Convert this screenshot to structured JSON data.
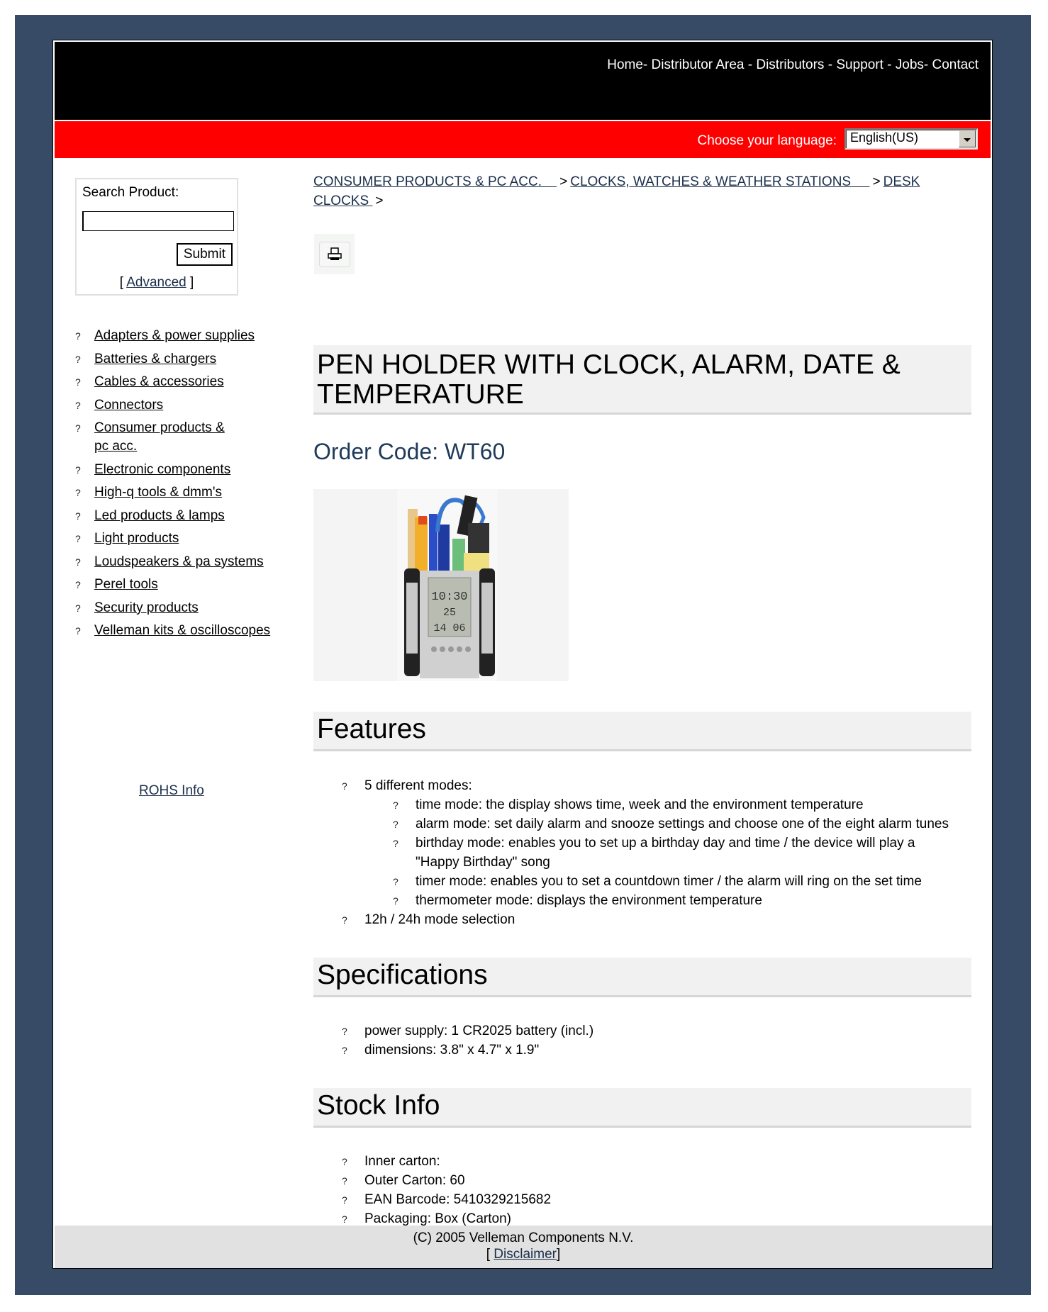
{
  "header": {
    "nav": [
      {
        "label": "Home"
      },
      {
        "label": "Distributor Area"
      },
      {
        "label": "Distributors"
      },
      {
        "label": "Support"
      },
      {
        "label": "Jobs"
      },
      {
        "label": "Contact"
      }
    ],
    "nav_separator": "-"
  },
  "language": {
    "label": "Choose your language:",
    "selected": "English(US)"
  },
  "search": {
    "label": "Search Product:",
    "value": "",
    "submit_label": "Submit",
    "advanced_prefix": "[",
    "advanced_label": "Advanced",
    "advanced_suffix": "]"
  },
  "categories": [
    {
      "label": "Adapters & power supplies"
    },
    {
      "label": "Batteries & chargers"
    },
    {
      "label": "Cables & accessories"
    },
    {
      "label": "Connectors"
    },
    {
      "label": "Consumer products & pc acc."
    },
    {
      "label": "Electronic components"
    },
    {
      "label": "High-q tools & dmm's"
    },
    {
      "label": "Led products & lamps"
    },
    {
      "label": "Light products"
    },
    {
      "label": "Loudspeakers & pa systems"
    },
    {
      "label": "Perel tools"
    },
    {
      "label": "Security products"
    },
    {
      "label": "Velleman kits & oscilloscopes"
    }
  ],
  "bullet_glyph": "?",
  "rohs_label": "ROHS Info",
  "breadcrumb": {
    "items": [
      {
        "label": "CONSUMER PRODUCTS & PC ACC."
      },
      {
        "label": "CLOCKS, WATCHES & WEATHER STATIONS"
      },
      {
        "label": "DESK CLOCKS"
      }
    ],
    "separator": ">"
  },
  "product": {
    "title": "PEN HOLDER WITH CLOCK, ALARM, DATE & TEMPERATURE",
    "order_code_label": "Order Code:",
    "order_code": "WT60",
    "image_alt": "Pen holder with LCD clock display showing 10:30, 25, 14 06"
  },
  "features": {
    "heading": "Features",
    "items": [
      {
        "text": "5 different modes:",
        "sub": [
          "time mode: the display shows time, week and the environment temperature",
          "alarm mode: set daily alarm and snooze settings and choose one of the eight alarm tunes",
          "birthday mode: enables you to set up a birthday day and time / the device will play a \"Happy Birthday\" song",
          "timer mode: enables you to set a countdown timer / the alarm will ring on the set time",
          "thermometer mode: displays the environment temperature"
        ]
      },
      {
        "text": "12h / 24h mode selection",
        "sub": []
      }
    ]
  },
  "specifications": {
    "heading": "Specifications",
    "items": [
      "power supply: 1 CR2025 battery (incl.)",
      "dimensions: 3.8\" x 4.7\" x 1.9\""
    ]
  },
  "stock": {
    "heading": "Stock Info",
    "items": [
      "Inner carton:",
      "Outer Carton: 60",
      "EAN Barcode: 5410329215682",
      "Packaging: Box (Carton)"
    ]
  },
  "footer": {
    "copyright": "(C) 2005 Velleman Components N.V.",
    "disclaimer_prefix": "[",
    "disclaimer_label": "Disclaimer",
    "disclaimer_suffix": "]"
  },
  "colors": {
    "page_frame": "#374a66",
    "header_bg": "#000000",
    "language_bar": "#ff0000",
    "link": "#1a2e4a",
    "order_code": "#1f3a5a",
    "section_head_bg": "#f1f1f1",
    "footer_bg": "#e1e1e1"
  }
}
